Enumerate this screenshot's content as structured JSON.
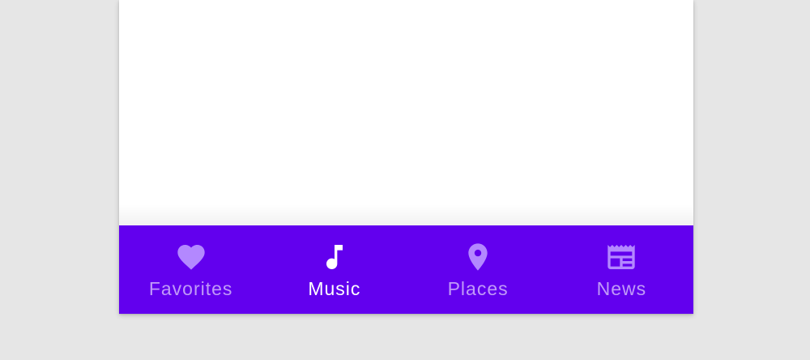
{
  "colors": {
    "background": "#e6e6e6",
    "surface": "#ffffff",
    "nav_bar": "#6200ee",
    "active_label": "#ffffff",
    "inactive_label": "rgba(255,255,255,0.6)",
    "inactive_icon": "#b388ff"
  },
  "bottom_nav": {
    "active_index": 1,
    "items": [
      {
        "label": "Favorites",
        "icon": "heart-icon"
      },
      {
        "label": "Music",
        "icon": "music-note-icon"
      },
      {
        "label": "Places",
        "icon": "location-pin-icon"
      },
      {
        "label": "News",
        "icon": "newspaper-icon"
      }
    ]
  }
}
